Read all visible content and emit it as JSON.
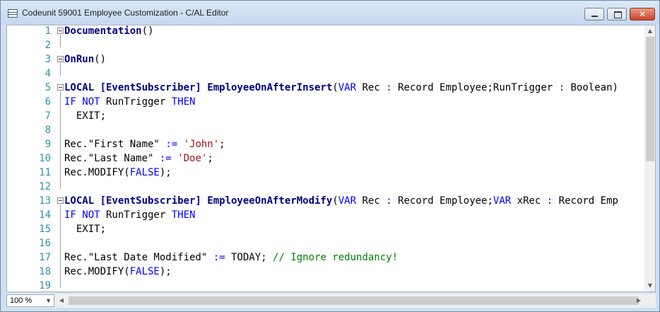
{
  "window": {
    "title": "Codeunit 59001 Employee Customization - C/AL Editor",
    "close_glyph": "✕"
  },
  "editor": {
    "lines": [
      {
        "n": "1",
        "fold": true,
        "segments": [
          {
            "t": "Documentation",
            "c": "bold"
          },
          {
            "t": "()",
            "c": ""
          }
        ]
      },
      {
        "n": "2",
        "fold": false,
        "segments": []
      },
      {
        "n": "3",
        "fold": true,
        "segments": [
          {
            "t": "OnRun",
            "c": "bold"
          },
          {
            "t": "()",
            "c": ""
          }
        ]
      },
      {
        "n": "4",
        "fold": false,
        "segments": []
      },
      {
        "n": "5",
        "fold": true,
        "segments": [
          {
            "t": "LOCAL [EventSubscriber] EmployeeOnAfterInsert",
            "c": "bold"
          },
          {
            "t": "(",
            "c": ""
          },
          {
            "t": "VAR",
            "c": "kw"
          },
          {
            "t": " Rec ",
            "c": ""
          },
          {
            "t": ":",
            "c": "op"
          },
          {
            "t": " Record Employee;RunTrigger ",
            "c": ""
          },
          {
            "t": ":",
            "c": "op"
          },
          {
            "t": " Boolean)",
            "c": ""
          }
        ]
      },
      {
        "n": "6",
        "fold": false,
        "segments": [
          {
            "t": "IF NOT",
            "c": "kw"
          },
          {
            "t": " RunTrigger ",
            "c": ""
          },
          {
            "t": "THEN",
            "c": "kw"
          }
        ]
      },
      {
        "n": "7",
        "fold": false,
        "segments": [
          {
            "t": "  EXIT;",
            "c": ""
          }
        ]
      },
      {
        "n": "8",
        "fold": false,
        "segments": []
      },
      {
        "n": "9",
        "fold": false,
        "segments": [
          {
            "t": "Rec.\"First Name\" ",
            "c": ""
          },
          {
            "t": ":=",
            "c": "op"
          },
          {
            "t": " ",
            "c": ""
          },
          {
            "t": "'John'",
            "c": "str"
          },
          {
            "t": ";",
            "c": ""
          }
        ]
      },
      {
        "n": "10",
        "fold": false,
        "segments": [
          {
            "t": "Rec.\"Last Name\" ",
            "c": ""
          },
          {
            "t": ":=",
            "c": "op"
          },
          {
            "t": " ",
            "c": ""
          },
          {
            "t": "'Doe'",
            "c": "str"
          },
          {
            "t": ";",
            "c": ""
          }
        ]
      },
      {
        "n": "11",
        "fold": false,
        "segments": [
          {
            "t": "Rec.MODIFY(",
            "c": ""
          },
          {
            "t": "FALSE",
            "c": "kw"
          },
          {
            "t": ");",
            "c": ""
          }
        ]
      },
      {
        "n": "12",
        "fold": false,
        "segments": []
      },
      {
        "n": "13",
        "fold": true,
        "segments": [
          {
            "t": "LOCAL [EventSubscriber] EmployeeOnAfterModify",
            "c": "bold"
          },
          {
            "t": "(",
            "c": ""
          },
          {
            "t": "VAR",
            "c": "kw"
          },
          {
            "t": " Rec ",
            "c": ""
          },
          {
            "t": ":",
            "c": "op"
          },
          {
            "t": " Record Employee;",
            "c": ""
          },
          {
            "t": "VAR",
            "c": "kw"
          },
          {
            "t": " xRec ",
            "c": ""
          },
          {
            "t": ":",
            "c": "op"
          },
          {
            "t": " Record Emp",
            "c": ""
          }
        ]
      },
      {
        "n": "14",
        "fold": false,
        "segments": [
          {
            "t": "IF NOT",
            "c": "kw"
          },
          {
            "t": " RunTrigger ",
            "c": ""
          },
          {
            "t": "THEN",
            "c": "kw"
          }
        ]
      },
      {
        "n": "15",
        "fold": false,
        "segments": [
          {
            "t": "  EXIT;",
            "c": ""
          }
        ]
      },
      {
        "n": "16",
        "fold": false,
        "segments": []
      },
      {
        "n": "17",
        "fold": false,
        "segments": [
          {
            "t": "Rec.\"Last Date Modified\" ",
            "c": ""
          },
          {
            "t": ":=",
            "c": "op"
          },
          {
            "t": " TODAY; ",
            "c": ""
          },
          {
            "t": "// Ignore redundancy!",
            "c": "cmt"
          }
        ]
      },
      {
        "n": "18",
        "fold": false,
        "segments": [
          {
            "t": "Rec.MODIFY(",
            "c": ""
          },
          {
            "t": "FALSE",
            "c": "kw"
          },
          {
            "t": ");",
            "c": ""
          }
        ]
      },
      {
        "n": "19",
        "fold": false,
        "segments": []
      }
    ]
  },
  "statusbar": {
    "zoom_value": "100 %"
  },
  "colors": {
    "line_number": "#2b91af",
    "keyword": "#0000ff",
    "string": "#a31515",
    "comment": "#008000"
  }
}
